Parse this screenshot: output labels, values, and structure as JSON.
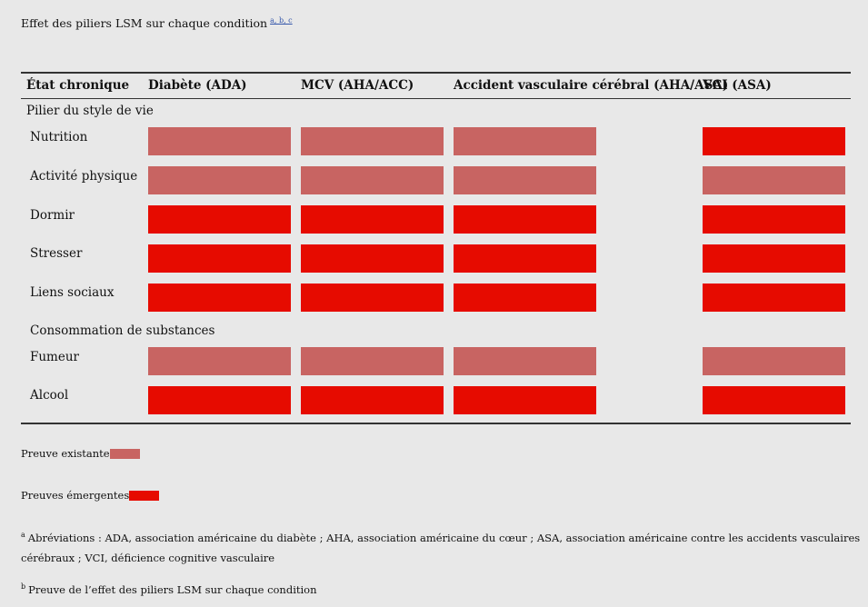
{
  "caption": {
    "text": "Effet des piliers LSM sur chaque condition",
    "refs": "a, b, c"
  },
  "colors": {
    "existing": "#c86462",
    "emerging": "#e60b00"
  },
  "headers": [
    "État chronique",
    "Diabète (ADA)",
    "MCV (AHA/ACC)",
    "Accident vasculaire cérébral (AHA/ASA)",
    "VCI (ASA)"
  ],
  "sections": {
    "lifestyle": "Pilier du style de vie",
    "substances": "Consommation de substances"
  },
  "rows": [
    {
      "label": "Nutrition",
      "cells": [
        "existing",
        "existing",
        "existing",
        "emerging"
      ]
    },
    {
      "label": "Activité physique",
      "cells": [
        "existing",
        "existing",
        "existing",
        "existing"
      ]
    },
    {
      "label": "Dormir",
      "cells": [
        "emerging",
        "emerging",
        "emerging",
        "emerging"
      ]
    },
    {
      "label": "Stresser",
      "cells": [
        "emerging",
        "emerging",
        "emerging",
        "emerging"
      ]
    },
    {
      "label": "Liens sociaux",
      "cells": [
        "emerging",
        "emerging",
        "emerging",
        "emerging"
      ]
    },
    {
      "label": "Fumeur",
      "cells": [
        "existing",
        "existing",
        "existing",
        "existing"
      ]
    },
    {
      "label": "Alcool",
      "cells": [
        "emerging",
        "emerging",
        "emerging",
        "emerging"
      ]
    }
  ],
  "legend": {
    "existing": "Preuve existante",
    "emerging": "Preuves émergentes"
  },
  "footnotes": {
    "a_mark": "a",
    "a": "Abréviations : ADA, association américaine du diabète ; AHA, association américaine du cœur ; ASA, association américaine contre les accidents vasculaires cérébraux ; VCI, déficience cognitive vasculaire",
    "b_mark": "b",
    "b": "Preuve de l’effet des piliers LSM sur chaque condition"
  }
}
